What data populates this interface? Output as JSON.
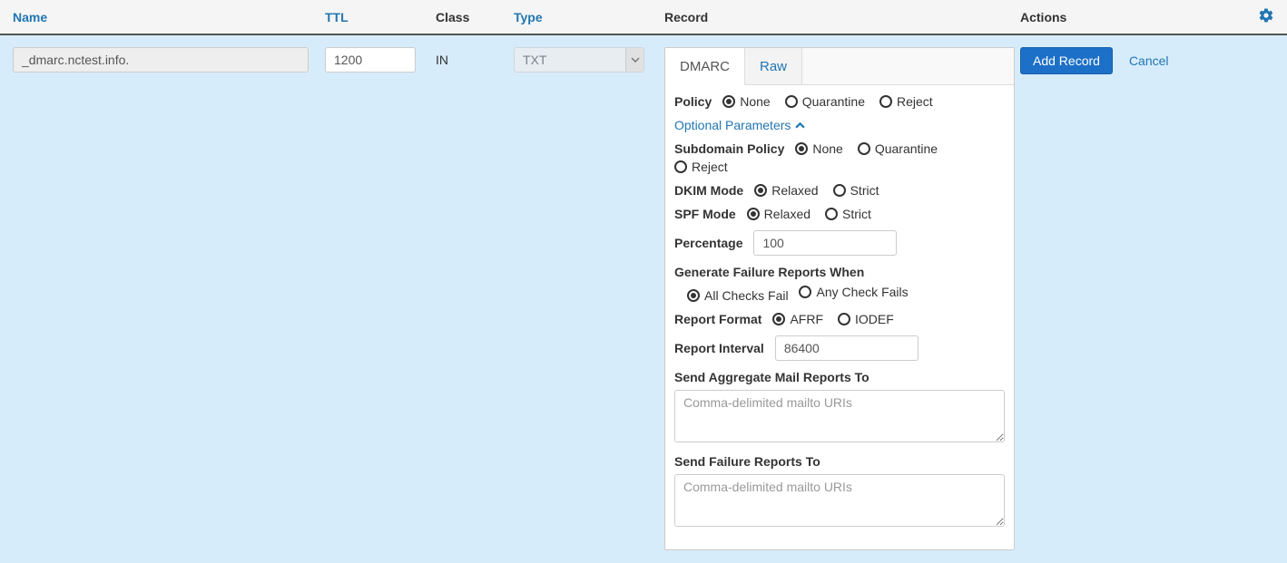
{
  "columns": {
    "name": "Name",
    "ttl": "TTL",
    "class": "Class",
    "type": "Type",
    "record": "Record",
    "actions": "Actions"
  },
  "row": {
    "name": "_dmarc.nctest.info.",
    "ttl": "1200",
    "class": "IN",
    "type": "TXT"
  },
  "tabs": {
    "dmarc": "DMARC",
    "raw": "Raw"
  },
  "form": {
    "policy_label": "Policy",
    "policy_none": "None",
    "policy_quarantine": "Quarantine",
    "policy_reject": "Reject",
    "optional_params": "Optional Parameters",
    "subdomain_policy_label": "Subdomain Policy",
    "dkim_mode_label": "DKIM Mode",
    "relaxed": "Relaxed",
    "strict": "Strict",
    "spf_mode_label": "SPF Mode",
    "percentage_label": "Percentage",
    "percentage_value": "100",
    "failure_reports_label": "Generate Failure Reports When",
    "all_checks_fail": "All Checks Fail",
    "any_check_fails": "Any Check Fails",
    "report_format_label": "Report Format",
    "afrf": "AFRF",
    "iodef": "IODEF",
    "report_interval_label": "Report Interval",
    "report_interval_value": "86400",
    "aggregate_label": "Send Aggregate Mail Reports To",
    "failure_to_label": "Send Failure Reports To",
    "mailto_placeholder": "Comma-delimited mailto URIs"
  },
  "actions": {
    "add_record": "Add Record",
    "cancel": "Cancel"
  }
}
